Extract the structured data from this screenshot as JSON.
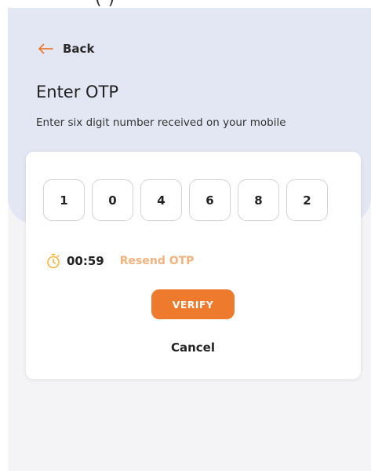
{
  "status_bar": {
    "fragment": "(       )"
  },
  "header": {
    "back_label": "Back",
    "back_icon": "arrow-left-icon",
    "title": "Enter OTP",
    "subtitle": "Enter six digit number received on your mobile"
  },
  "otp": {
    "digits": [
      "1",
      "0",
      "4",
      "6",
      "8",
      "2"
    ]
  },
  "timer": {
    "icon": "stopwatch-icon",
    "time": "00:59",
    "resend_label": "Resend OTP"
  },
  "actions": {
    "verify_label": "VERIFY",
    "cancel_label": "Cancel"
  },
  "colors": {
    "accent": "#ee7a2e",
    "resend": "#f4b27e",
    "header_band": "#e3e6f3",
    "page_background": "#f4f4f6",
    "card": "#ffffff"
  }
}
